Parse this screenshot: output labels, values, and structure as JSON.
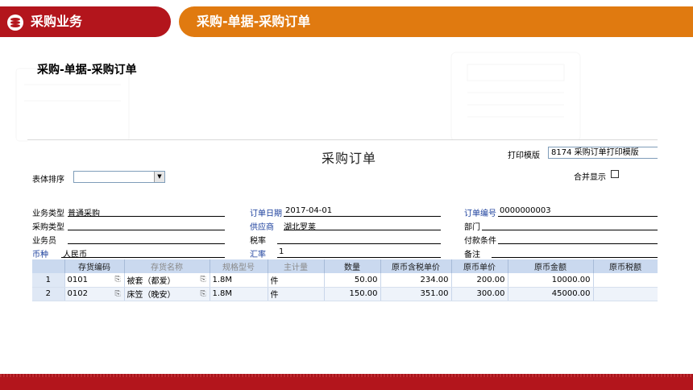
{
  "header": {
    "left_title": "采购业务",
    "right_title": "采购-单据-采购订单"
  },
  "page_title": "采购-单据-采购订单",
  "form": {
    "title": "采购订单",
    "print_template_label": "打印模版",
    "print_template_value": "8174 采购订单打印模版",
    "sort_label": "表体排序",
    "merge_label": "合并显示",
    "fields": {
      "biz_type_label": "业务类型",
      "biz_type_value": "普通采购",
      "order_date_label": "订单日期",
      "order_date_value": "2017-04-01",
      "order_no_label": "订单编号",
      "order_no_value": "0000000003",
      "purchase_type_label": "采购类型",
      "supplier_label": "供应商",
      "supplier_value": "湖北罗莱",
      "dept_label": "部门",
      "salesman_label": "业务员",
      "tax_rate_label": "税率",
      "payment_terms_label": "付款条件",
      "currency_label": "币种",
      "currency_value": "人民币",
      "exchange_rate_label": "汇率",
      "exchange_rate_value": "1",
      "remark_label": "备注"
    }
  },
  "grid": {
    "columns": [
      "",
      "存货编码",
      "存货名称",
      "规格型号",
      "主计量",
      "数量",
      "原币含税单价",
      "原币单价",
      "原币金额",
      "原币税额"
    ],
    "rows": [
      {
        "idx": "1",
        "code": "0101",
        "name": "被套（都爱）",
        "spec": "1.8M",
        "unit": "件",
        "qty": "50.00",
        "tax_price": "234.00",
        "price": "200.00",
        "amount": "10000.00",
        "tax": ""
      },
      {
        "idx": "2",
        "code": "0102",
        "name": "床笠（晚安）",
        "spec": "1.8M",
        "unit": "件",
        "qty": "150.00",
        "tax_price": "351.00",
        "price": "300.00",
        "amount": "45000.00",
        "tax": ""
      }
    ]
  },
  "colors": {
    "brand_red": "#b3151c",
    "brand_orange": "#e07a10",
    "grid_header": "#cad9ef"
  },
  "icons": {
    "header_logo": "stacked-coins-icon",
    "attachment": "paperclip-icon",
    "dropdown": "dropdown-arrow-icon"
  }
}
